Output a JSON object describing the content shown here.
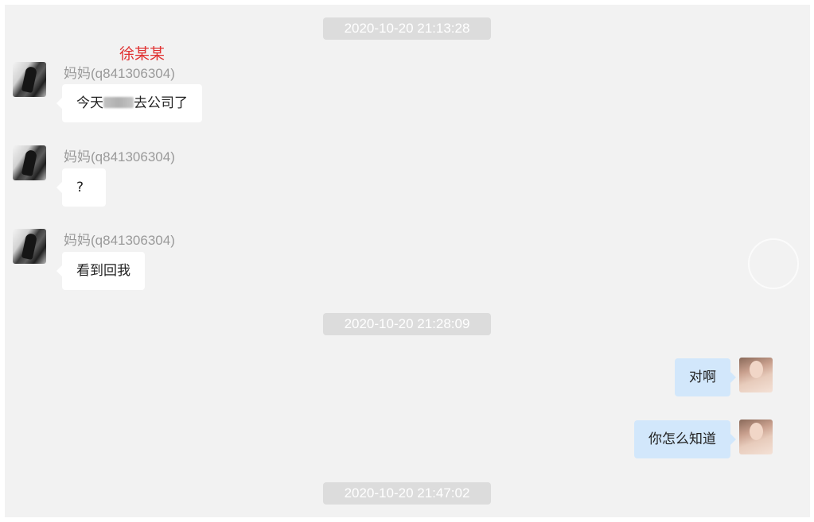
{
  "annotation": {
    "text": "徐某某",
    "color": "#e03131"
  },
  "colors": {
    "background": "#f2f2f2",
    "timestamp_bg": "#dcdcdc",
    "incoming_bubble": "#ffffff",
    "outgoing_bubble": "#d2e7fb"
  },
  "timestamps": [
    "2020-10-20 21:13:28",
    "2020-10-20 21:28:09",
    "2020-10-20 21:47:02"
  ],
  "messages": [
    {
      "direction": "incoming",
      "sender": "妈妈(q841306304)",
      "text_before": "今天",
      "redacted": true,
      "text_after": "去公司了",
      "avatar": "mom-avatar"
    },
    {
      "direction": "incoming",
      "sender": "妈妈(q841306304)",
      "text": "?",
      "avatar": "mom-avatar"
    },
    {
      "direction": "incoming",
      "sender": "妈妈(q841306304)",
      "text": "看到回我",
      "avatar": "mom-avatar"
    },
    {
      "direction": "outgoing",
      "text": "对啊",
      "avatar": "my-avatar"
    },
    {
      "direction": "outgoing",
      "text": "你怎么知道",
      "avatar": "my-avatar"
    }
  ]
}
